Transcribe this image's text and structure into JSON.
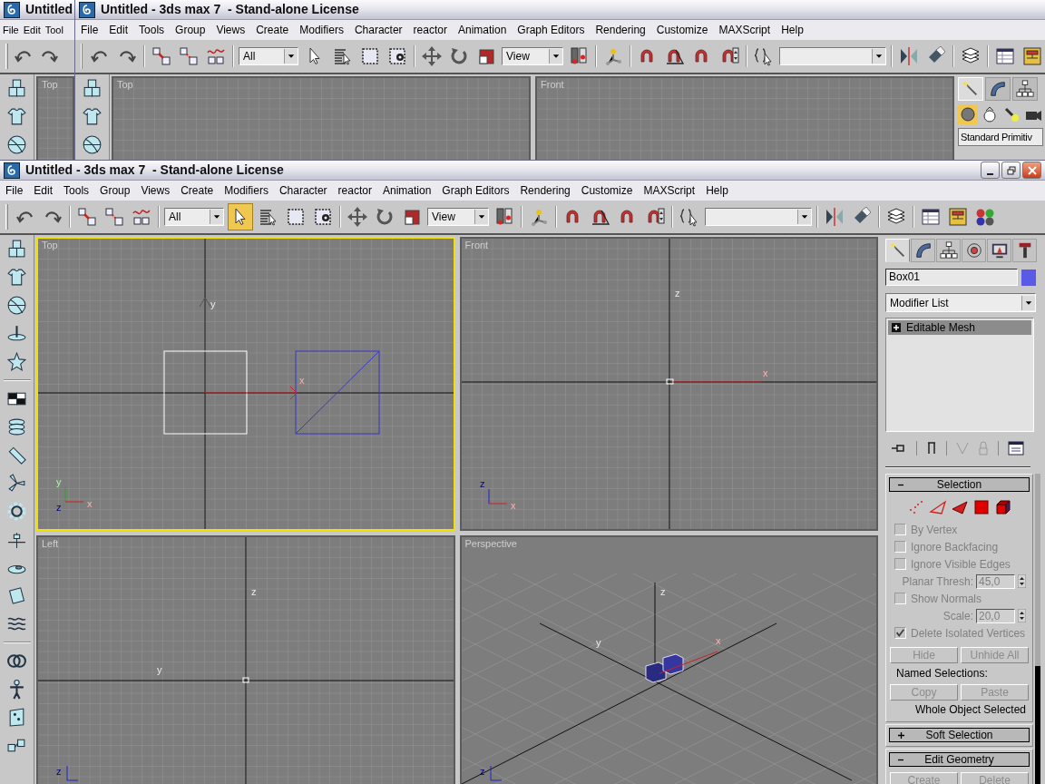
{
  "back_windows": [
    {
      "kind": "narrow",
      "title": "Untitled",
      "menu": [
        "File",
        "Edit",
        "Tool"
      ],
      "viewports": [
        {
          "label": "Top"
        }
      ]
    },
    {
      "kind": "full",
      "title": "Untitled - 3ds max 7  - Stand-alone License",
      "menu": [
        "File",
        "Edit",
        "Tools",
        "Group",
        "Views",
        "Create",
        "Modifiers",
        "Character",
        "reactor",
        "Animation",
        "Graph Editors",
        "Rendering",
        "Customize",
        "MAXScript",
        "Help"
      ],
      "toolbar": {
        "selection_filter": "All",
        "reference_coordinate": "View",
        "select_active": false
      },
      "viewports": [
        {
          "label": "Top"
        },
        {
          "label": "Front"
        }
      ],
      "command_panel": {
        "tabs": [
          {
            "selected": true
          },
          {
            "selected": false
          },
          {
            "selected": false
          }
        ],
        "categories": [
          {
            "selected": true
          },
          {
            "selected": false
          },
          {
            "selected": false
          },
          {
            "selected": false
          }
        ],
        "object_type": "Standard Primitiv"
      }
    }
  ],
  "window": {
    "title": "Untitled - 3ds max 7  - Stand-alone License",
    "menu": [
      "File",
      "Edit",
      "Tools",
      "Group",
      "Views",
      "Create",
      "Modifiers",
      "Character",
      "reactor",
      "Animation",
      "Graph Editors",
      "Rendering",
      "Customize",
      "MAXScript",
      "Help"
    ],
    "toolbar": {
      "selection_filter": "All",
      "reference_coordinate": "View",
      "select_active": true
    },
    "viewports": [
      {
        "kind": "top",
        "label": "Top",
        "selected": true,
        "axis_labels": [
          "y",
          "x",
          "y",
          "z",
          "x"
        ]
      },
      {
        "kind": "front",
        "label": "Front",
        "selected": false,
        "axis_labels": [
          "z",
          "x",
          "z",
          "x"
        ]
      },
      {
        "kind": "left",
        "label": "Left",
        "selected": false,
        "axis_labels": [
          "z",
          "y",
          "z"
        ]
      },
      {
        "kind": "perspective",
        "label": "Perspective",
        "selected": false,
        "axis_labels": [
          "z",
          "y",
          "x",
          "z"
        ]
      }
    ],
    "command_panel": {
      "tabs": [
        {
          "selected": true
        },
        {
          "selected": false
        },
        {
          "selected": false
        },
        {
          "selected": false
        },
        {
          "selected": false
        },
        {
          "selected": false
        }
      ],
      "object_name": "Box01",
      "modifier_list": "Modifier List",
      "stack": [
        {
          "label": "Editable Mesh",
          "selected": true,
          "expanded": false
        }
      ],
      "rollouts": [
        {
          "title": "Selection",
          "expanded": true,
          "levels": [
            {
              "selected": false
            },
            {
              "selected": false
            },
            {
              "selected": false
            },
            {
              "selected": false
            },
            {
              "selected": false
            }
          ],
          "controls": [
            {
              "kind": "checkbox",
              "label": "By Vertex",
              "checked": false,
              "disabled": true
            },
            {
              "kind": "checkbox",
              "label": "Ignore Backfacing",
              "checked": false,
              "disabled": true
            },
            {
              "kind": "checkbox",
              "label": "Ignore Visible Edges",
              "checked": false,
              "disabled": true
            },
            {
              "kind": "spinner",
              "label": "Planar Thresh:",
              "value": "45,0",
              "disabled": true
            },
            {
              "kind": "checkbox",
              "label": "Show Normals",
              "checked": false,
              "disabled": true
            },
            {
              "kind": "spinner",
              "label": "Scale:",
              "value": "20,0",
              "disabled": true
            },
            {
              "kind": "checkbox",
              "label": "Delete Isolated Vertices",
              "checked": true,
              "disabled": true
            }
          ],
          "buttons": [
            {
              "label": "Hide",
              "disabled": true
            },
            {
              "label": "Unhide All",
              "disabled": true
            }
          ],
          "named_selections": {
            "label": "Named Selections:",
            "buttons": [
              {
                "label": "Copy",
                "disabled": true
              },
              {
                "label": "Paste",
                "disabled": true
              }
            ]
          },
          "status": "Whole Object Selected"
        },
        {
          "title": "Soft Selection",
          "expanded": false
        },
        {
          "title": "Edit Geometry",
          "expanded": true,
          "buttons": [
            {
              "label": "Create",
              "disabled": true
            },
            {
              "label": "Delete",
              "disabled": true
            }
          ]
        }
      ]
    }
  }
}
